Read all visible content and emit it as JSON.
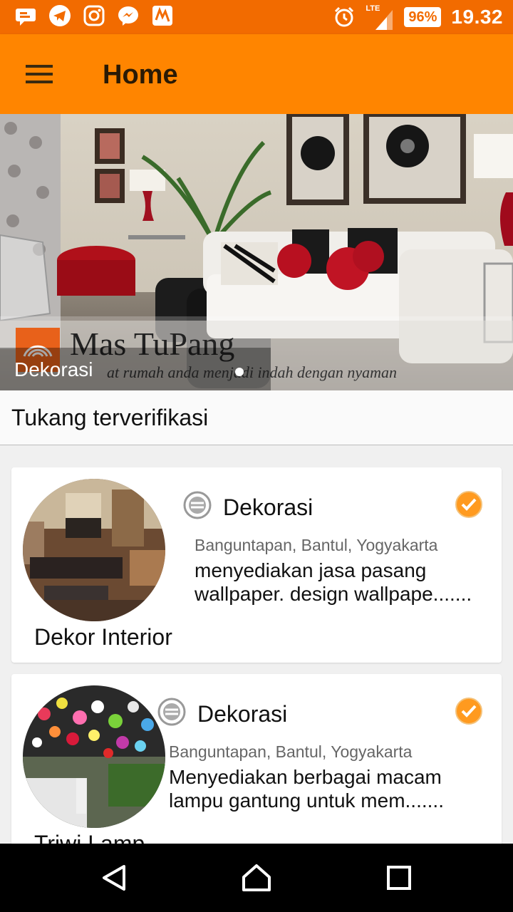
{
  "status_bar": {
    "time": "19.32",
    "battery": "96%",
    "network": "LTE",
    "left_icons": [
      "message-icon",
      "telegram-icon",
      "instagram-icon",
      "messenger-icon",
      "app-icon"
    ],
    "right_icons": [
      "alarm-icon",
      "signal-icon",
      "battery-icon"
    ]
  },
  "app_bar": {
    "title": "Home",
    "accent": "#ff8500"
  },
  "banner": {
    "brand": "Mas TuPang",
    "tagline": "at rumah anda menjadi indah dengan nyaman",
    "caption": "Dekorasi"
  },
  "section": {
    "title": "Tukang terverifikasi"
  },
  "vendors": [
    {
      "name": "Dekor Interior",
      "category": "Dekorasi",
      "location": "Banguntapan, Bantul, Yogyakarta",
      "description": "menyediakan jasa pasang wallpaper. design wallpape.......",
      "verified": true
    },
    {
      "name": "Triwi Lamp",
      "category": "Dekorasi",
      "location": "Banguntapan, Bantul, Yogyakarta",
      "description": "Menyediakan berbagai macam lampu gantung untuk mem.......",
      "verified": true
    }
  ],
  "nav": {
    "icons": [
      "back-icon",
      "home-icon",
      "recents-icon"
    ]
  }
}
